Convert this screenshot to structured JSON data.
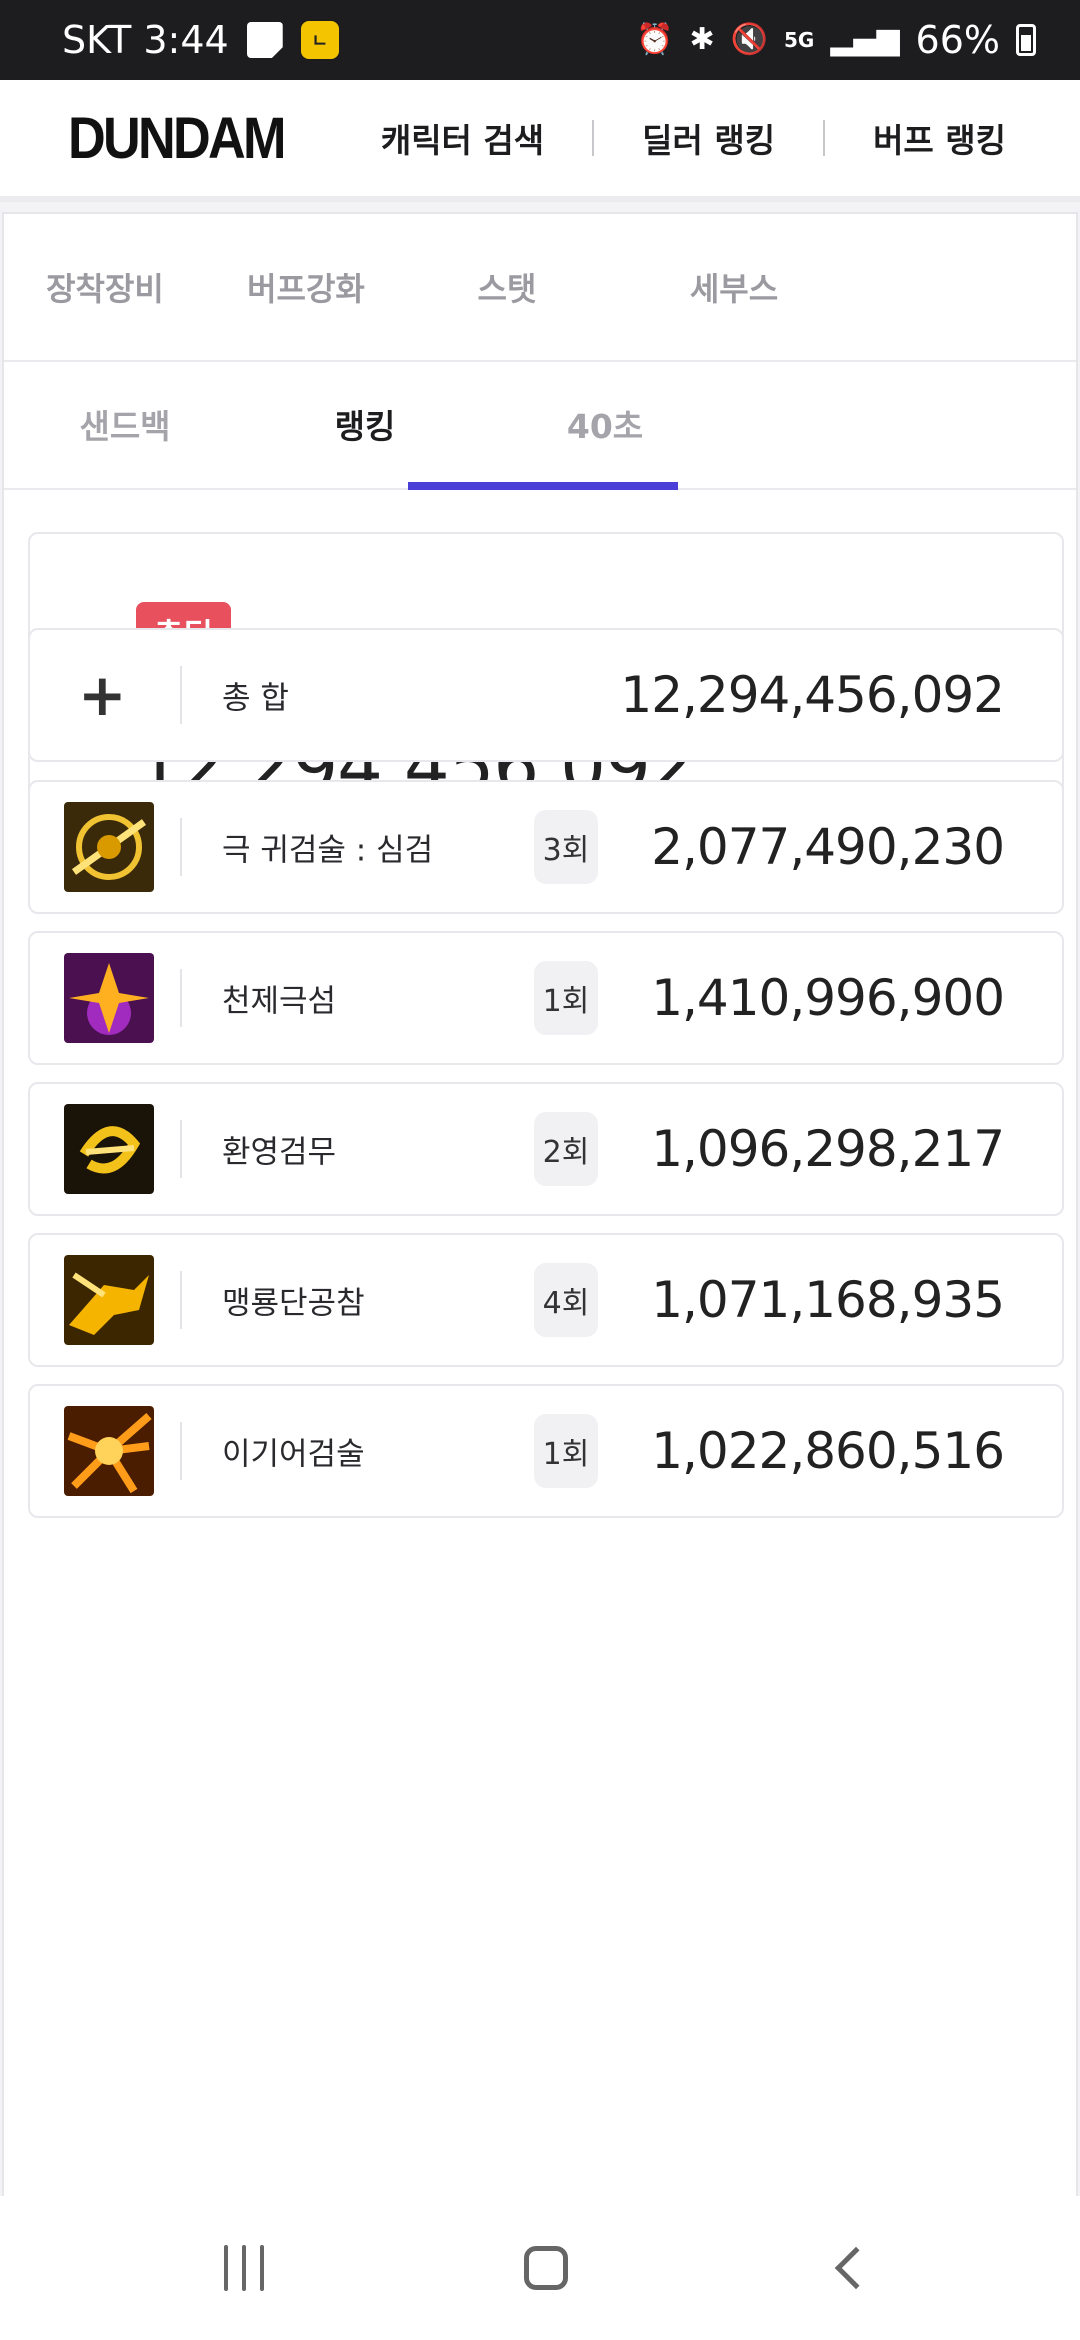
{
  "status_bar": {
    "carrier_time": "SKT 3:44",
    "notif_b": "ㄴ",
    "battery": "66%"
  },
  "header": {
    "logo": "DUNDAM",
    "nav": [
      "캐릭터 검색",
      "딜러 랭킹",
      "버프 랭킹"
    ]
  },
  "sub_tabs": [
    "장착장비",
    "버프강화",
    "스탯",
    "세부스"
  ],
  "main_tabs": {
    "items": [
      "샌드백",
      "랭킹",
      "40초"
    ],
    "active": "랭킹"
  },
  "total": {
    "badge": "총딜",
    "value": "12,294,456,092"
  },
  "summary": {
    "name": "총 합",
    "value": "12,294,456,092"
  },
  "skills": [
    {
      "name": "극 귀검술 : 심검",
      "count": "3회",
      "value": "2,077,490,230"
    },
    {
      "name": "천제극섬",
      "count": "1회",
      "value": "1,410,996,900"
    },
    {
      "name": "환영검무",
      "count": "2회",
      "value": "1,096,298,217"
    },
    {
      "name": "맹룡단공참",
      "count": "4회",
      "value": "1,071,168,935"
    },
    {
      "name": "이기어검술",
      "count": "1회",
      "value": "1,022,860,516"
    }
  ]
}
